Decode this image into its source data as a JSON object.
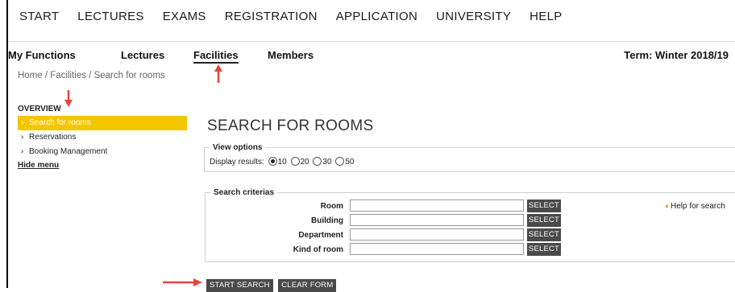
{
  "top_nav": [
    "START",
    "LECTURES",
    "EXAMS",
    "REGISTRATION",
    "APPLICATION",
    "UNIVERSITY",
    "HELP"
  ],
  "sub_nav": {
    "my_functions": "My Functions",
    "lectures": "Lectures",
    "facilities": "Facilities",
    "members": "Members",
    "term": "Term: Winter 2018/19"
  },
  "breadcrumb": "Home  / Facilities / Search for rooms",
  "sidebar": {
    "overview": "OVERVIEW",
    "items": [
      "Search for rooms",
      "Reservations",
      "Booking Management"
    ],
    "hide_menu": "Hide menu"
  },
  "main": {
    "title": "SEARCH FOR ROOMS",
    "view_options": {
      "legend": "View options",
      "display_label": "Display results:",
      "options": [
        "10",
        "20",
        "30",
        "50"
      ],
      "selected": "10"
    },
    "search": {
      "legend": "Search criterias",
      "fields": [
        {
          "label": "Room",
          "value": ""
        },
        {
          "label": "Building",
          "value": ""
        },
        {
          "label": "Department",
          "value": ""
        },
        {
          "label": "Kind of room",
          "value": ""
        }
      ],
      "select_label": "SELECT",
      "help": "Help for search"
    },
    "start_search": "START SEARCH",
    "clear_form": "CLEAR FORM"
  },
  "annotations": {
    "arrow_color": "#e8443a"
  }
}
